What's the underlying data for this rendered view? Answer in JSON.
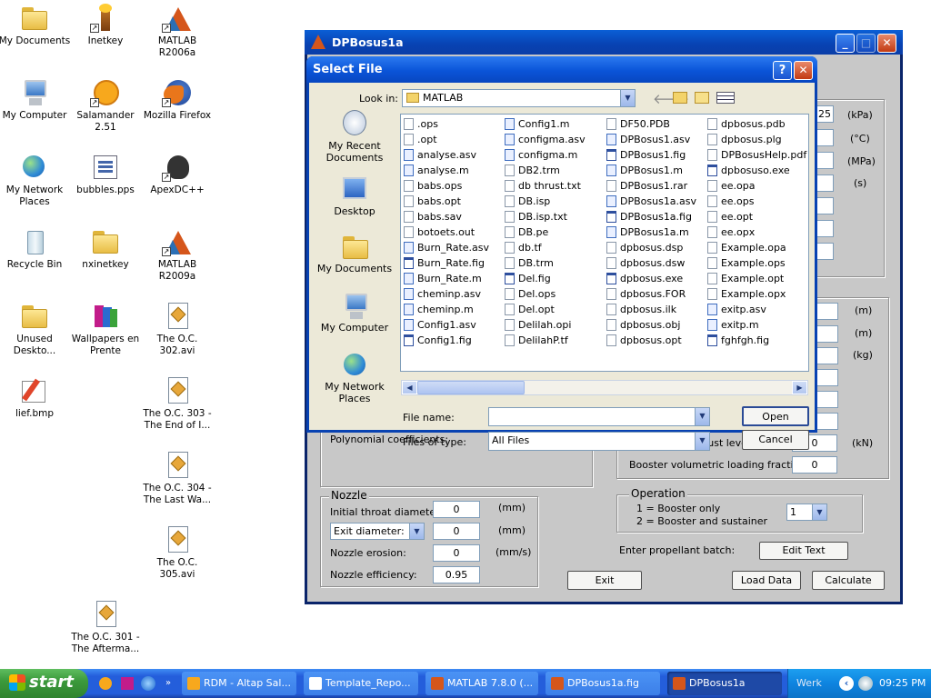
{
  "desktop": {
    "icons": [
      {
        "label": "My Documents"
      },
      {
        "label": "Inetkey"
      },
      {
        "label": "MATLAB R2006a"
      },
      {
        "label": "My Computer"
      },
      {
        "label": "Salamander 2.51"
      },
      {
        "label": "Mozilla Firefox"
      },
      {
        "label": "My Network Places"
      },
      {
        "label": "bubbles.pps"
      },
      {
        "label": "ApexDC++"
      },
      {
        "label": "Recycle Bin"
      },
      {
        "label": "nxinetkey"
      },
      {
        "label": "MATLAB R2009a"
      },
      {
        "label": "Unused Deskto..."
      },
      {
        "label": "Wallpapers en Prente"
      },
      {
        "label": "The O.C. 302.avi"
      },
      {
        "label": "lief.bmp"
      },
      {
        "label": "The O.C. 303 - The End of I..."
      },
      {
        "label": "The O.C. 304 - The Last Wa..."
      },
      {
        "label": "The O.C. 305.avi"
      },
      {
        "label": "The O.C. 301 - The Afterma..."
      }
    ]
  },
  "dpwindow": {
    "title": "DPBosus1a",
    "units_top": [
      "(kPa)",
      "(°C)",
      "(MPa)",
      "(s)"
    ],
    "top_partial_value": "25",
    "units_mid": [
      "(m)",
      "(m)",
      "(kg)"
    ],
    "poly_label": "Polynomial coefficients:",
    "lower_boost_label": "Lower boost thrust level:",
    "lower_boost_value": "0",
    "lower_boost_unit": "(kN)",
    "booster_frac_label": "Booster volumetric loading fraction:",
    "booster_frac_value": "0",
    "nozzle": {
      "title": "Nozzle",
      "throat_label": "Initial throat diameter:",
      "throat_value": "0",
      "throat_unit": "(mm)",
      "exit_select": "Exit diameter:",
      "exit_value": "0",
      "exit_unit": "(mm)",
      "erosion_label": "Nozzle erosion:",
      "erosion_value": "0",
      "erosion_unit": "(mm/s)",
      "efficiency_label": "Nozzle efficiency:",
      "efficiency_value": "0.95"
    },
    "operation": {
      "title": "Operation",
      "line1": "1 = Booster only",
      "line2": "2 = Booster and sustainer",
      "value": "1"
    },
    "propellant_label": "Enter propellant batch:",
    "edit_text_button": "Edit Text",
    "exit_button": "Exit",
    "load_button": "Load Data",
    "calc_button": "Calculate"
  },
  "dialog": {
    "title": "Select File",
    "look_in_label": "Look in:",
    "look_in_value": "MATLAB",
    "places": [
      {
        "label": "My Recent Documents"
      },
      {
        "label": "Desktop"
      },
      {
        "label": "My Documents"
      },
      {
        "label": "My Computer"
      },
      {
        "label": "My Network Places"
      }
    ],
    "columns": [
      [
        ".ops",
        ".opt",
        "analyse.asv",
        "analyse.m",
        "babs.ops",
        "babs.opt",
        "babs.sav",
        "botoets.out",
        "Burn_Rate.asv",
        "Burn_Rate.fig",
        "Burn_Rate.m",
        "cheminp.asv",
        "cheminp.m",
        "Config1.asv",
        "Config1.fig"
      ],
      [
        "Config1.m",
        "configma.asv",
        "configma.m",
        "DB2.trm",
        "db thrust.txt",
        "DB.isp",
        "DB.isp.txt",
        "DB.pe",
        "db.tf",
        "DB.trm",
        "Del.fig",
        "Del.ops",
        "Del.opt",
        "Delilah.opi",
        "DelilahP.tf"
      ],
      [
        "DF50.PDB",
        "DPBosus1.asv",
        "DPBosus1.fig",
        "DPBosus1.m",
        "DPBosus1.rar",
        "DPBosus1a.asv",
        "DPBosus1a.fig",
        "DPBosus1a.m",
        "dpbosus.dsp",
        "dpbosus.dsw",
        "dpbosus.exe",
        "dpbosus.FOR",
        "dpbosus.ilk",
        "dpbosus.obj",
        "dpbosus.opt"
      ],
      [
        "dpbosus.pdb",
        "dpbosus.plg",
        "DPBosusHelp.pdf",
        "dpbosuso.exe",
        "ee.opa",
        "ee.ops",
        "ee.opt",
        "ee.opx",
        "Example.opa",
        "Example.ops",
        "Example.opt",
        "Example.opx",
        "exitp.asv",
        "exitp.m",
        "fghfgh.fig"
      ]
    ],
    "file_name_label": "File name:",
    "file_name_value": "",
    "file_type_label": "Files of type:",
    "file_type_value": "All Files",
    "open_button": "Open",
    "cancel_button": "Cancel",
    "help_glyph": "?",
    "close_glyph": "✕"
  },
  "taskbar": {
    "start_label": "start",
    "tasks": [
      {
        "label": "RDM - Altap Sal..."
      },
      {
        "label": "Template_Repo..."
      },
      {
        "label": "MATLAB  7.8.0 (..."
      },
      {
        "label": "DPBosus1a.fig"
      },
      {
        "label": "DPBosus1a"
      }
    ],
    "tray_text": "Werk",
    "clock": "09:25 PM"
  },
  "colors": {
    "title_blue": "#0a54d8",
    "taskbar_blue": "#245edb",
    "start_green": "#3c9a3c",
    "dialog_face": "#ece9d8",
    "gui_gray": "#c8c8c8"
  }
}
